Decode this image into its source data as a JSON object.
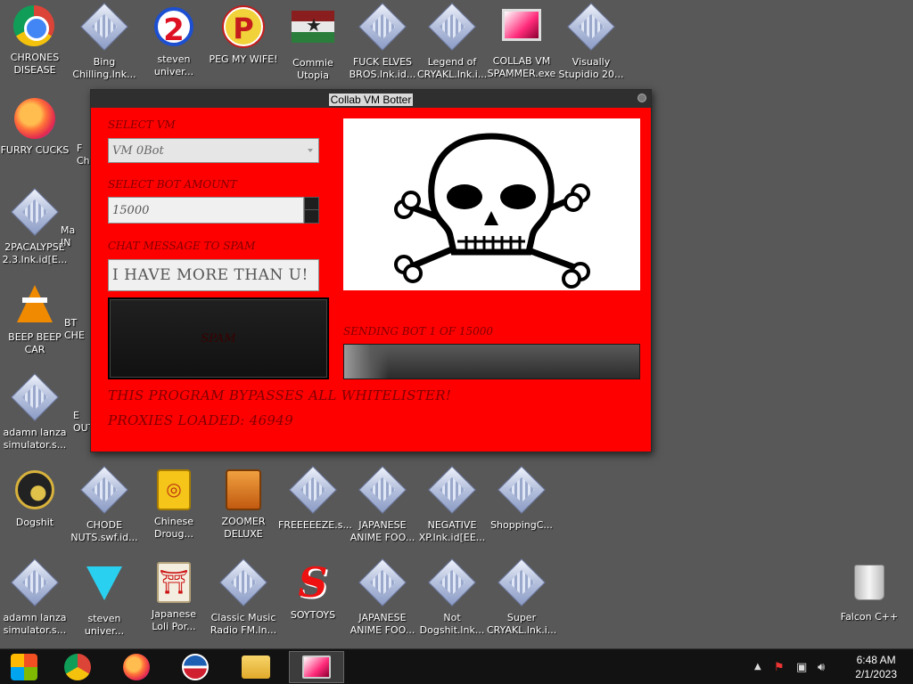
{
  "desktop": {
    "icons": [
      {
        "label": "CHRONES\nDISEASE",
        "icon": "chrome-icon"
      },
      {
        "label": "Bing\nChilling.lnk...",
        "icon": "shortcut-icon"
      },
      {
        "label": "steven\nuniver...",
        "icon": "number-2-badge-icon"
      },
      {
        "label": "PEG MY WIFE!",
        "icon": "p-button-icon"
      },
      {
        "label": "Commie\nUtopia",
        "icon": "flag-icon"
      },
      {
        "label": "FUCK ELVES\nBROS.lnk.id...",
        "icon": "shortcut-icon"
      },
      {
        "label": "Legend of\nCRYAKL.lnk.i...",
        "icon": "shortcut-icon"
      },
      {
        "label": "COLLAB VM\nSPAMMER.exe",
        "icon": "monitor-icon"
      },
      {
        "label": "Visually\nStupidio 20...",
        "icon": "shortcut-icon"
      },
      {
        "label": "FURRY CUCKS",
        "icon": "firefox-icon"
      },
      {
        "label": "2PACALYPSE\n2.3.lnk.id[E...",
        "icon": "shortcut-icon"
      },
      {
        "label": "BEEP BEEP\nCAR",
        "icon": "vlc-cone-icon"
      },
      {
        "label": "adamn lanza\nsimulator.s...",
        "icon": "shortcut-icon"
      },
      {
        "label": "Dogshit",
        "icon": "dogshit-icon"
      },
      {
        "label": "CHODE\nNUTS.swf.id...",
        "icon": "shortcut-icon"
      },
      {
        "label": "Chinese\nDroug...",
        "icon": "mahjong-icon"
      },
      {
        "label": "ZOOMER\nDELUXE",
        "icon": "zoomer-icon"
      },
      {
        "label": "FREEEEEZE.s...",
        "icon": "shortcut-icon"
      },
      {
        "label": "JAPANESE\nANIME FOO...",
        "icon": "shortcut-icon"
      },
      {
        "label": "NEGATIVE\nXP.lnk.id[EE...",
        "icon": "shortcut-icon"
      },
      {
        "label": "ShoppingC...",
        "icon": "shortcut-icon"
      },
      {
        "label": "adamn lanza\nsimulator.s...",
        "icon": "shortcut-icon"
      },
      {
        "label": "steven\nuniver...",
        "icon": "diamond-gem-icon"
      },
      {
        "label": "Japanese\nLoli Por...",
        "icon": "torii-tile-icon"
      },
      {
        "label": "Classic Music\nRadio FM.ln...",
        "icon": "shortcut-icon"
      },
      {
        "label": "SOYTOYS",
        "icon": "s-logo-icon"
      },
      {
        "label": "JAPANESE\nANIME FOO...",
        "icon": "shortcut-icon"
      },
      {
        "label": "Not\nDogshit.lnk...",
        "icon": "shortcut-icon"
      },
      {
        "label": "Super\nCRYAKL.lnk.i...",
        "icon": "shortcut-icon"
      },
      {
        "label": "Falcon C++",
        "icon": "recycle-bin-icon"
      }
    ],
    "partial_labels": [
      "Ma\nIN",
      "BT\nCHE",
      "E\nOUT",
      "F\nCh"
    ]
  },
  "window": {
    "title": "Collab VM Botter",
    "select_vm_label": "SELECT VM",
    "select_vm_value": "VM 0Bot",
    "bot_amount_label": "SELECT BOT AMOUNT",
    "bot_amount_value": "15000",
    "chat_label": "CHAT MESSAGE TO SPAM",
    "chat_value": "I HAVE MORE THAN U!",
    "start_label": "SPAM",
    "progress_label": "SENDING BOT 1 OF 15000",
    "progress_value": 0.15,
    "bypass_text": "THIS PROGRAM BYPASSES ALL WHITELISTER!",
    "proxies_text": "PROXIES LOADED: 46949",
    "image_icon": "skull-crossbones-icon"
  },
  "taskbar": {
    "apps": [
      "start-orb-icon",
      "chrome-icon",
      "firefox-icon",
      "obama-logo-icon",
      "file-explorer-icon",
      "collab-vm-spammer-icon"
    ],
    "active_index": 5,
    "clock_time": "6:48 AM",
    "clock_date": "2/1/2023",
    "tray_icons": [
      "show-hidden-icon",
      "action-center-flag-icon",
      "network-icon",
      "volume-icon"
    ]
  }
}
